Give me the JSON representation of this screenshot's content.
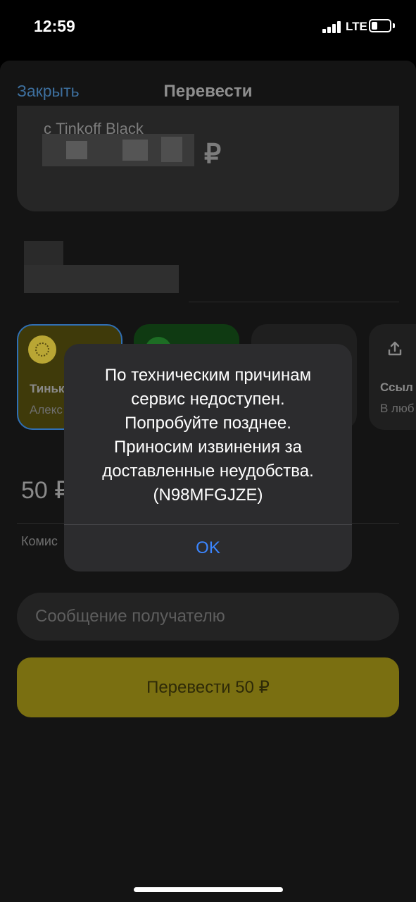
{
  "status_bar": {
    "time": "12:59",
    "network": "LTE"
  },
  "header": {
    "close_label": "Закрыть",
    "title": "Перевести"
  },
  "source": {
    "label": "с Tinkoff Black",
    "currency_symbol": "₽"
  },
  "methods": [
    {
      "name": "Тиньк",
      "sub": "Алекс"
    },
    {
      "name": "",
      "sub": ""
    },
    {
      "name": "",
      "sub": ""
    },
    {
      "name": "Ссыл",
      "sub": "В люб"
    }
  ],
  "amount": {
    "value": "50 ₽"
  },
  "commission": {
    "label": "Комис"
  },
  "message_field": {
    "placeholder": "Сообщение получателю"
  },
  "submit": {
    "label": "Перевести 50 ₽"
  },
  "alert": {
    "lines": [
      "По техническим причинам",
      "сервис недоступен.",
      "Попробуйте позднее.",
      "Приносим извинения за",
      "доставленные неудобства.",
      "(N98MFGJZE)"
    ],
    "ok_label": "OK"
  },
  "colors": {
    "accent_yellow": "#7a6f11",
    "link_blue": "#3d6f9e",
    "alert_button_blue": "#3b86ff",
    "selected_border": "#2f6fb5"
  },
  "icons": [
    "signal-icon",
    "battery-icon",
    "tinkoff-logo-icon",
    "sber-logo-icon",
    "upload-icon"
  ]
}
